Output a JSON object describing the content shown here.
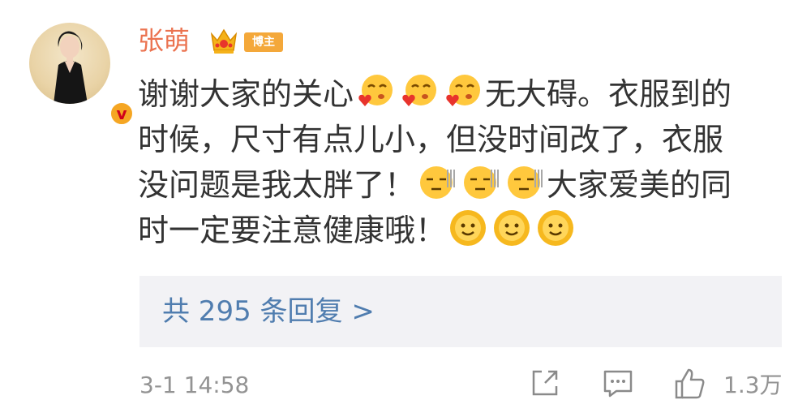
{
  "user": {
    "name": "张萌",
    "tag": "博主",
    "verified_icon": "v-badge-icon"
  },
  "post": {
    "lines": [
      {
        "before": "谢谢大家的关心",
        "emoji": "heart-kiss",
        "after": "无大碍。衣服到的"
      },
      {
        "before": "时候，尺寸有点儿小，但没时间改了，衣服",
        "emoji": "",
        "after": ""
      },
      {
        "before": "没问题是我太胖了！",
        "emoji": "shame",
        "after": "大家爱美的同"
      },
      {
        "before": "时一定要注意健康哦！",
        "emoji": "sun-smile",
        "after": ""
      }
    ]
  },
  "replies_link": "共 295 条回复 >",
  "footer": {
    "timestamp": "3-1 14:58",
    "share_icon": "share-icon",
    "comment_icon": "comment-icon",
    "like_icon": "thumbs-up-icon",
    "like_count": "1.3万"
  },
  "colors": {
    "username": "#eb7350",
    "link": "#507daf",
    "meta": "#939393",
    "reply_bg": "#f2f2f5"
  }
}
